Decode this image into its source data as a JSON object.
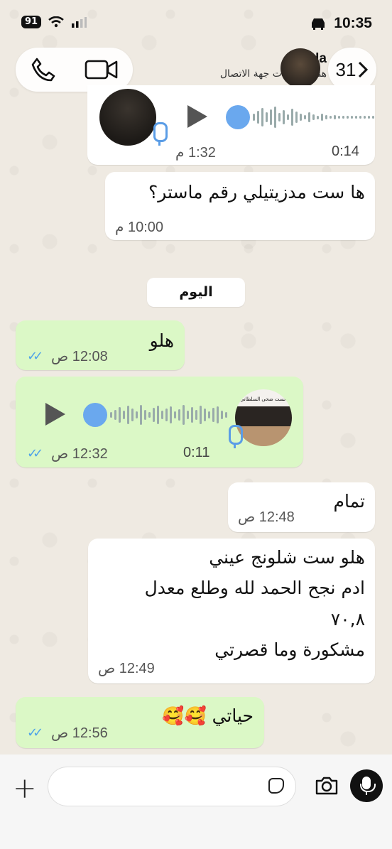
{
  "status_bar": {
    "battery": "91",
    "time": "10:35"
  },
  "header": {
    "contact_name": "Lola",
    "contact_subtitle": "هنا لمعلومات جهة الاتصال",
    "back_count": "31"
  },
  "messages": {
    "m1_voice": {
      "duration": "0:14",
      "time": "1:32 م"
    },
    "m2": {
      "text": "ها ست مدزيتيلي رقم ماستر؟",
      "time": "10:00 م"
    },
    "date_divider": "اليوم",
    "m3": {
      "text": "هلو",
      "time": "12:08 ص"
    },
    "m4_voice": {
      "duration": "0:11",
      "time": "12:32 ص",
      "avatar_caption": "الست ضحى السلطاني"
    },
    "m5": {
      "text": "تمام",
      "time": "12:48 ص"
    },
    "m6": {
      "line1": "هلو ست شلونج عيني",
      "line2": "ادم نجح الحمد لله وطلع معدل",
      "line3": "٧٠,٨",
      "line4": "مشكورة وما قصرتي",
      "time": "12:49 ص"
    },
    "m7": {
      "text": "حياتي 🥰🥰",
      "time": "12:56 ص"
    }
  },
  "colors": {
    "incoming": "#ffffff",
    "outgoing": "#dbf8c6",
    "read_ticks": "#4fa3e8",
    "voice_dot": "#6aa8ee"
  },
  "icons": [
    "phone-icon",
    "video-icon",
    "chevron-right-icon",
    "play-icon",
    "mic-icon",
    "plus-icon",
    "sticker-icon",
    "camera-icon"
  ]
}
